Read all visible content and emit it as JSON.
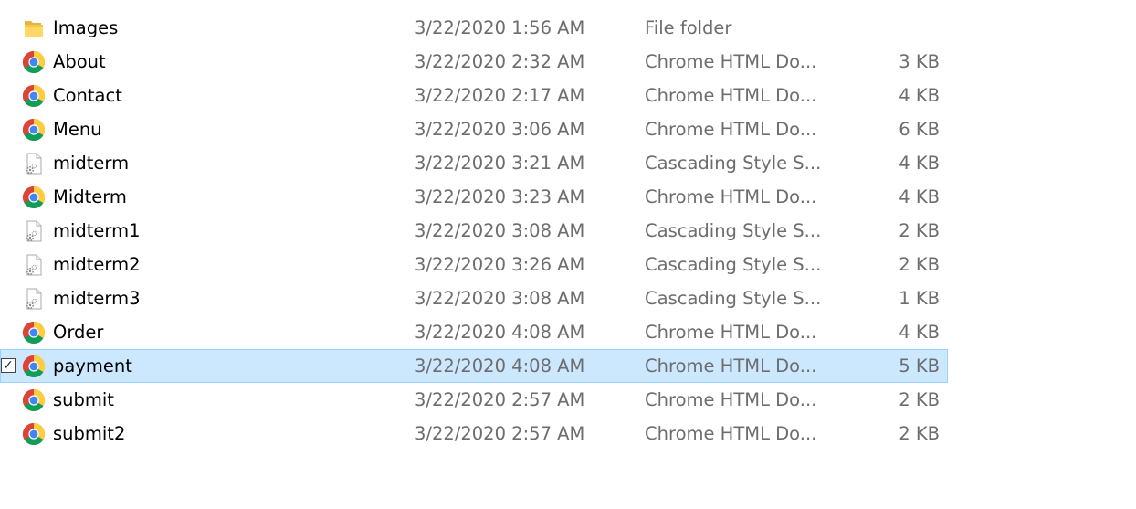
{
  "files": [
    {
      "name": "Images",
      "date": "3/22/2020 1:56 AM",
      "type": "File folder",
      "size": "",
      "icon": "folder-icon",
      "selected": false
    },
    {
      "name": "About",
      "date": "3/22/2020 2:32 AM",
      "type": "Chrome HTML Do...",
      "size": "3 KB",
      "icon": "chrome-icon",
      "selected": false
    },
    {
      "name": "Contact",
      "date": "3/22/2020 2:17 AM",
      "type": "Chrome HTML Do...",
      "size": "4 KB",
      "icon": "chrome-icon",
      "selected": false
    },
    {
      "name": "Menu",
      "date": "3/22/2020 3:06 AM",
      "type": "Chrome HTML Do...",
      "size": "6 KB",
      "icon": "chrome-icon",
      "selected": false
    },
    {
      "name": "midterm",
      "date": "3/22/2020 3:21 AM",
      "type": "Cascading Style S...",
      "size": "4 KB",
      "icon": "css-file-icon",
      "selected": false
    },
    {
      "name": "Midterm",
      "date": "3/22/2020 3:23 AM",
      "type": "Chrome HTML Do...",
      "size": "4 KB",
      "icon": "chrome-icon",
      "selected": false
    },
    {
      "name": "midterm1",
      "date": "3/22/2020 3:08 AM",
      "type": "Cascading Style S...",
      "size": "2 KB",
      "icon": "css-file-icon",
      "selected": false
    },
    {
      "name": "midterm2",
      "date": "3/22/2020 3:26 AM",
      "type": "Cascading Style S...",
      "size": "2 KB",
      "icon": "css-file-icon",
      "selected": false
    },
    {
      "name": "midterm3",
      "date": "3/22/2020 3:08 AM",
      "type": "Cascading Style S...",
      "size": "1 KB",
      "icon": "css-file-icon",
      "selected": false
    },
    {
      "name": "Order",
      "date": "3/22/2020 4:08 AM",
      "type": "Chrome HTML Do...",
      "size": "4 KB",
      "icon": "chrome-icon",
      "selected": false
    },
    {
      "name": "payment",
      "date": "3/22/2020 4:08 AM",
      "type": "Chrome HTML Do...",
      "size": "5 KB",
      "icon": "chrome-icon",
      "selected": true
    },
    {
      "name": "submit",
      "date": "3/22/2020 2:57 AM",
      "type": "Chrome HTML Do...",
      "size": "2 KB",
      "icon": "chrome-icon",
      "selected": false
    },
    {
      "name": "submit2",
      "date": "3/22/2020 2:57 AM",
      "type": "Chrome HTML Do...",
      "size": "2 KB",
      "icon": "chrome-icon",
      "selected": false
    }
  ],
  "colors": {
    "selection_bg": "#cce8ff",
    "selection_border": "#99d1ff",
    "detail_text": "#6d6d6d",
    "name_text": "#000000"
  }
}
